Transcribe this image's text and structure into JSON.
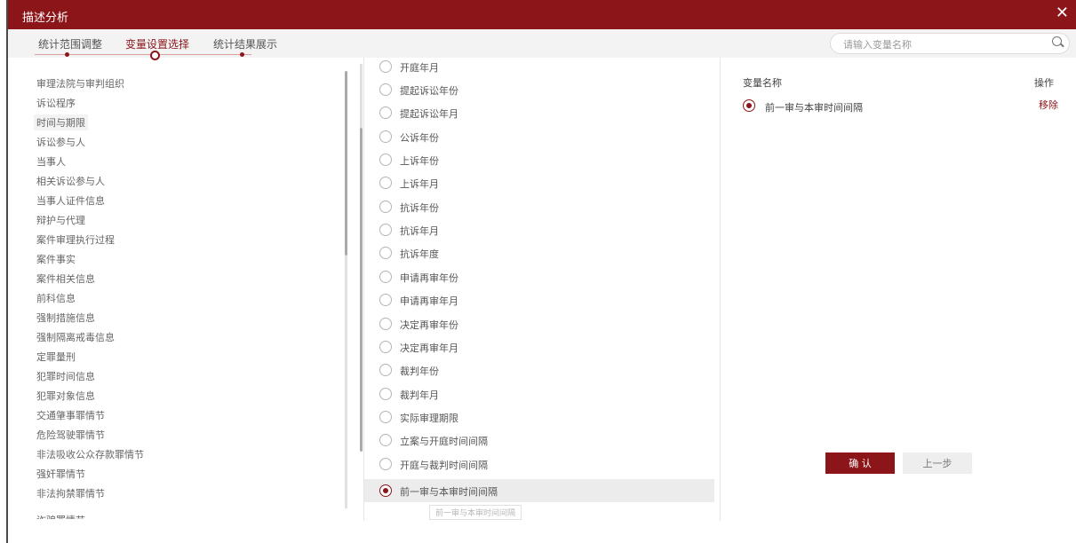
{
  "dialog": {
    "title": "描述分析",
    "close_icon": "close-icon"
  },
  "tabs": [
    {
      "label": "统计范围调整",
      "active": false
    },
    {
      "label": "变量设置选择",
      "active": true
    },
    {
      "label": "统计结果展示",
      "active": false
    }
  ],
  "search": {
    "placeholder": "请输入变量名称",
    "icon": "search-icon"
  },
  "categories": [
    {
      "label": "审理法院与审判组织"
    },
    {
      "label": "诉讼程序"
    },
    {
      "label": "时间与期限",
      "active": true
    },
    {
      "label": "诉讼参与人"
    },
    {
      "label": "当事人"
    },
    {
      "label": "相关诉讼参与人"
    },
    {
      "label": "当事人证件信息"
    },
    {
      "label": "辩护与代理"
    },
    {
      "label": "案件审理执行过程"
    },
    {
      "label": "案件事实"
    },
    {
      "label": "案件相关信息"
    },
    {
      "label": "前科信息"
    },
    {
      "label": "强制措施信息"
    },
    {
      "label": "强制隔离戒毒信息"
    },
    {
      "label": "定罪量刑"
    },
    {
      "label": "犯罪时间信息"
    },
    {
      "label": "犯罪对象信息"
    },
    {
      "label": "交通肇事罪情节"
    },
    {
      "label": "危险驾驶罪情节"
    },
    {
      "label": "非法吸收公众存款罪情节"
    },
    {
      "label": "强奸罪情节"
    },
    {
      "label": "非法拘禁罪情节"
    },
    {
      "label": "诈骗罪情节"
    }
  ],
  "variables": [
    {
      "label": "开庭年月",
      "selected": false
    },
    {
      "label": "提起诉讼年份",
      "selected": false
    },
    {
      "label": "提起诉讼年月",
      "selected": false
    },
    {
      "label": "公诉年份",
      "selected": false
    },
    {
      "label": "上诉年份",
      "selected": false
    },
    {
      "label": "上诉年月",
      "selected": false
    },
    {
      "label": "抗诉年份",
      "selected": false
    },
    {
      "label": "抗诉年月",
      "selected": false
    },
    {
      "label": "抗诉年度",
      "selected": false
    },
    {
      "label": "申请再审年份",
      "selected": false
    },
    {
      "label": "申请再审年月",
      "selected": false
    },
    {
      "label": "决定再审年份",
      "selected": false
    },
    {
      "label": "决定再审年月",
      "selected": false
    },
    {
      "label": "裁判年份",
      "selected": false
    },
    {
      "label": "裁判年月",
      "selected": false
    },
    {
      "label": "实际审理期限",
      "selected": false
    },
    {
      "label": "立案与开庭时间间隔",
      "selected": false
    },
    {
      "label": "开庭与裁判时间间隔",
      "selected": false
    },
    {
      "label": "前一审与本审时间间隔",
      "selected": true
    }
  ],
  "tooltip": "前一审与本审时间间隔",
  "selected_panel": {
    "header_name": "变量名称",
    "header_op": "操作",
    "rows": [
      {
        "label": "前一审与本审时间间隔",
        "remove_label": "移除"
      }
    ]
  },
  "buttons": {
    "confirm": "确 认",
    "prev": "上一步"
  },
  "colors": {
    "brand": "#8b1519",
    "tab_bar_bg": "#f3f3f3"
  }
}
